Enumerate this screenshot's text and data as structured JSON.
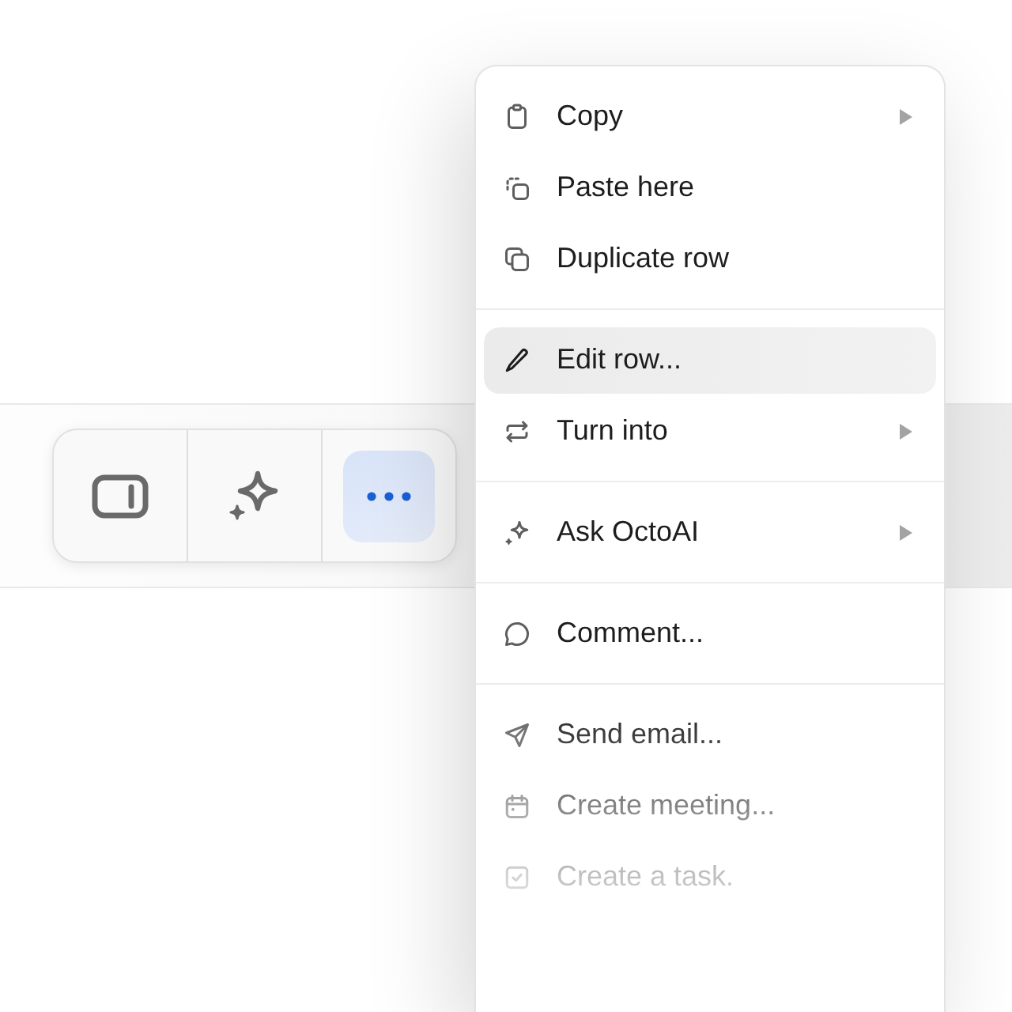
{
  "toolbar": {
    "buttons": [
      {
        "selected": false
      },
      {
        "selected": false
      },
      {
        "selected": true
      }
    ]
  },
  "menu": {
    "groups": [
      {
        "items": [
          {
            "label": "Copy",
            "submenu": true,
            "highlighted": false
          },
          {
            "label": "Paste here",
            "submenu": false,
            "highlighted": false
          },
          {
            "label": "Duplicate row",
            "submenu": false,
            "highlighted": false
          }
        ]
      },
      {
        "items": [
          {
            "label": "Edit row...",
            "submenu": false,
            "highlighted": true
          },
          {
            "label": "Turn into",
            "submenu": true,
            "highlighted": false
          }
        ]
      },
      {
        "items": [
          {
            "label": "Ask OctoAI",
            "submenu": true,
            "highlighted": false
          }
        ]
      },
      {
        "items": [
          {
            "label": "Comment...",
            "submenu": false,
            "highlighted": false
          }
        ]
      },
      {
        "items": [
          {
            "label": "Send email...",
            "submenu": false,
            "highlighted": false
          },
          {
            "label": "Create meeting...",
            "submenu": false,
            "highlighted": false
          },
          {
            "label": "Create a task.",
            "submenu": false,
            "highlighted": false
          }
        ]
      }
    ]
  }
}
